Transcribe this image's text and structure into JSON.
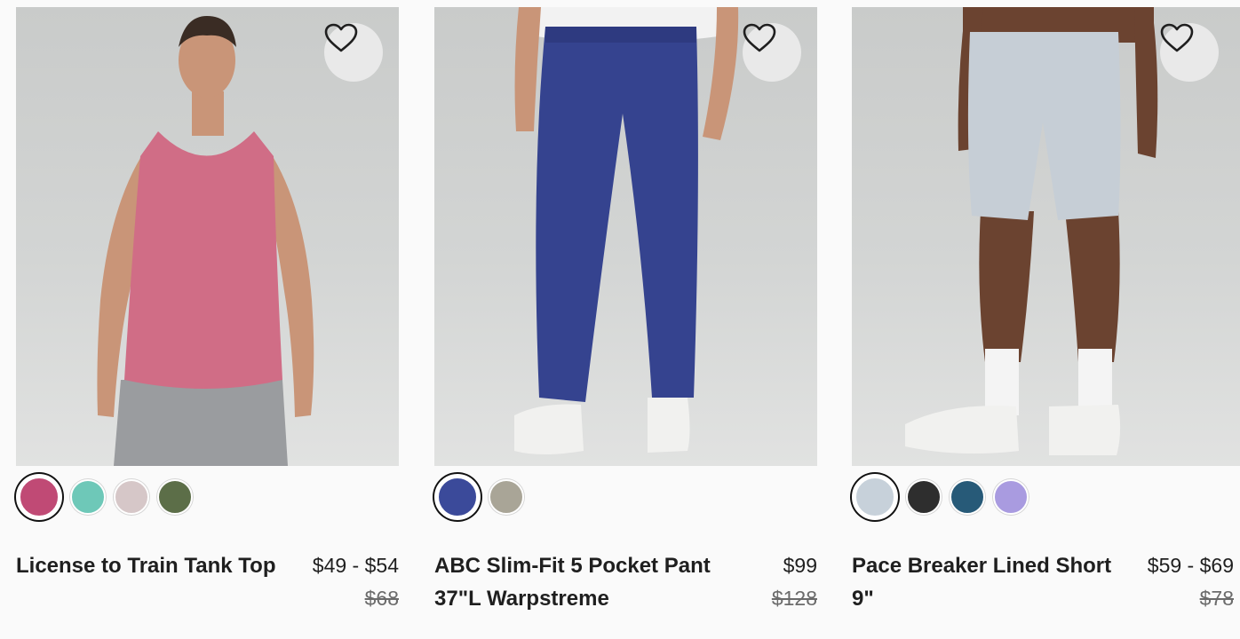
{
  "products": [
    {
      "name": "License to Train Tank Top",
      "price": "$49 - $54",
      "original_price": "$68",
      "swatches": [
        "#c04a75",
        "#6ec8b8",
        "#d6c7c8",
        "#5c6e48"
      ],
      "selected_swatch": 0,
      "wishlist_icon": "heart-outline-icon"
    },
    {
      "name": "ABC Slim-Fit 5 Pocket Pant 37\"L Warpstreme",
      "price": "$99",
      "original_price": "$128",
      "swatches": [
        "#3b4a9a",
        "#a9a597"
      ],
      "selected_swatch": 0,
      "wishlist_icon": "heart-outline-icon"
    },
    {
      "name": "Pace Breaker Lined Short 9\"",
      "price": "$59 - $69",
      "original_price": "$78",
      "swatches": [
        "#c7d1da",
        "#2e2e2e",
        "#275a78",
        "#a99be0"
      ],
      "selected_swatch": 0,
      "wishlist_icon": "heart-outline-icon"
    }
  ]
}
